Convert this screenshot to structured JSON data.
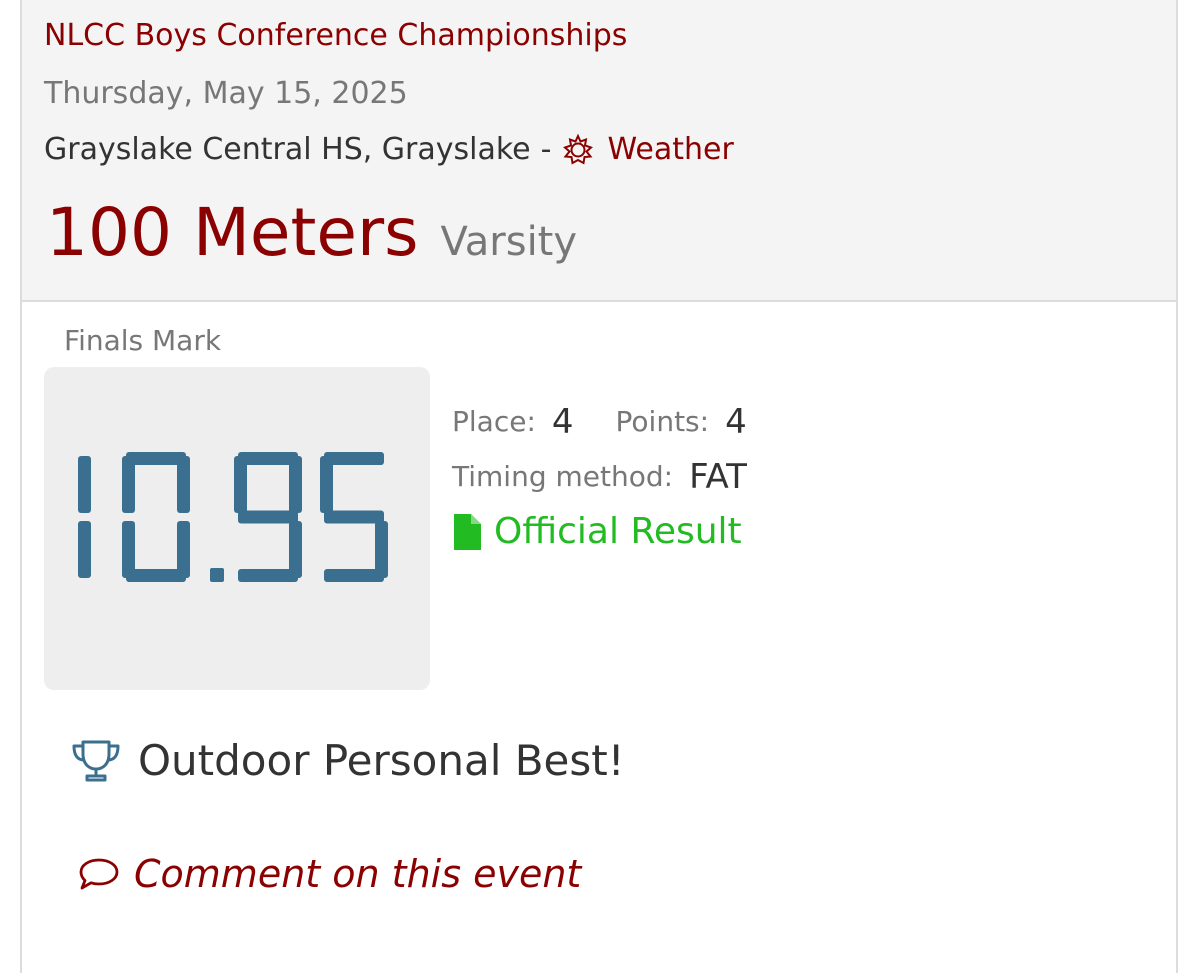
{
  "meet": {
    "name": "NLCC Boys Conference Championships",
    "date": "Thursday, May 15, 2025",
    "venue": "Grayslake Central HS, Grayslake",
    "separator": "-",
    "weather_label": "Weather"
  },
  "event": {
    "name": "100 Meters",
    "level": "Varsity"
  },
  "result": {
    "finals_label": "Finals Mark",
    "mark": "10.95",
    "place_label": "Place:",
    "place": "4",
    "points_label": "Points:",
    "points": "4",
    "timing_label": "Timing method:",
    "timing": "FAT",
    "official_label": "Official Result"
  },
  "personal_best": {
    "text": "Outdoor Personal Best!",
    "icon": "trophy-icon"
  },
  "comment": {
    "label": "Comment on this event",
    "icon": "speech-bubble-icon"
  },
  "colors": {
    "accent": "#8b0000",
    "muted": "#777777",
    "digit": "#3b6f8f",
    "official": "#22bb22",
    "header_bg": "#f4f4f4"
  }
}
